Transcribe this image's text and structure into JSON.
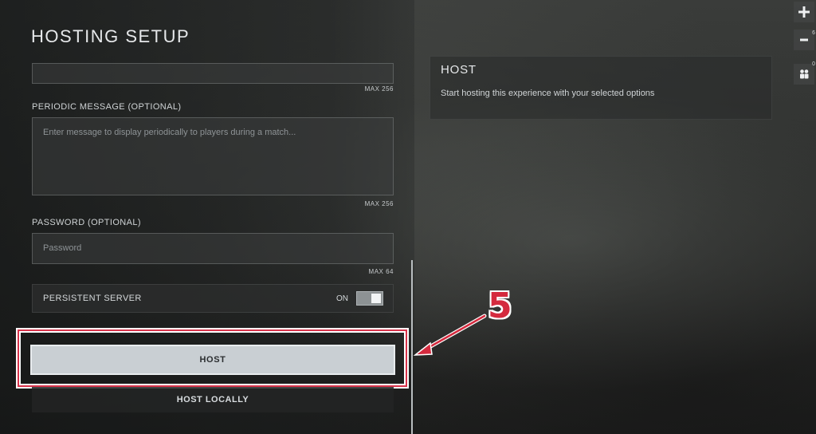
{
  "page_title": "HOSTING SETUP",
  "fields": {
    "top_field_max": "MAX 256",
    "periodic_message": {
      "label": "PERIODIC MESSAGE (OPTIONAL)",
      "placeholder": "Enter message to display periodically to players during a match...",
      "max": "MAX 256"
    },
    "password": {
      "label": "PASSWORD (OPTIONAL)",
      "placeholder": "Password",
      "max": "MAX 64"
    }
  },
  "persistent_server": {
    "label": "PERSISTENT SERVER",
    "state": "ON",
    "on": true
  },
  "buttons": {
    "host": "HOST",
    "host_locally": "HOST LOCALLY"
  },
  "info_panel": {
    "title": "HOST",
    "description": "Start hosting this experience with your selected options"
  },
  "side_rail": {
    "plus_icon": "plus-icon",
    "minus_icon": "minus-icon",
    "minus_count": "6",
    "players_icon": "players-icon",
    "players_count": "0"
  },
  "annotation": {
    "step_number": "5",
    "color": "#d42a3e"
  }
}
